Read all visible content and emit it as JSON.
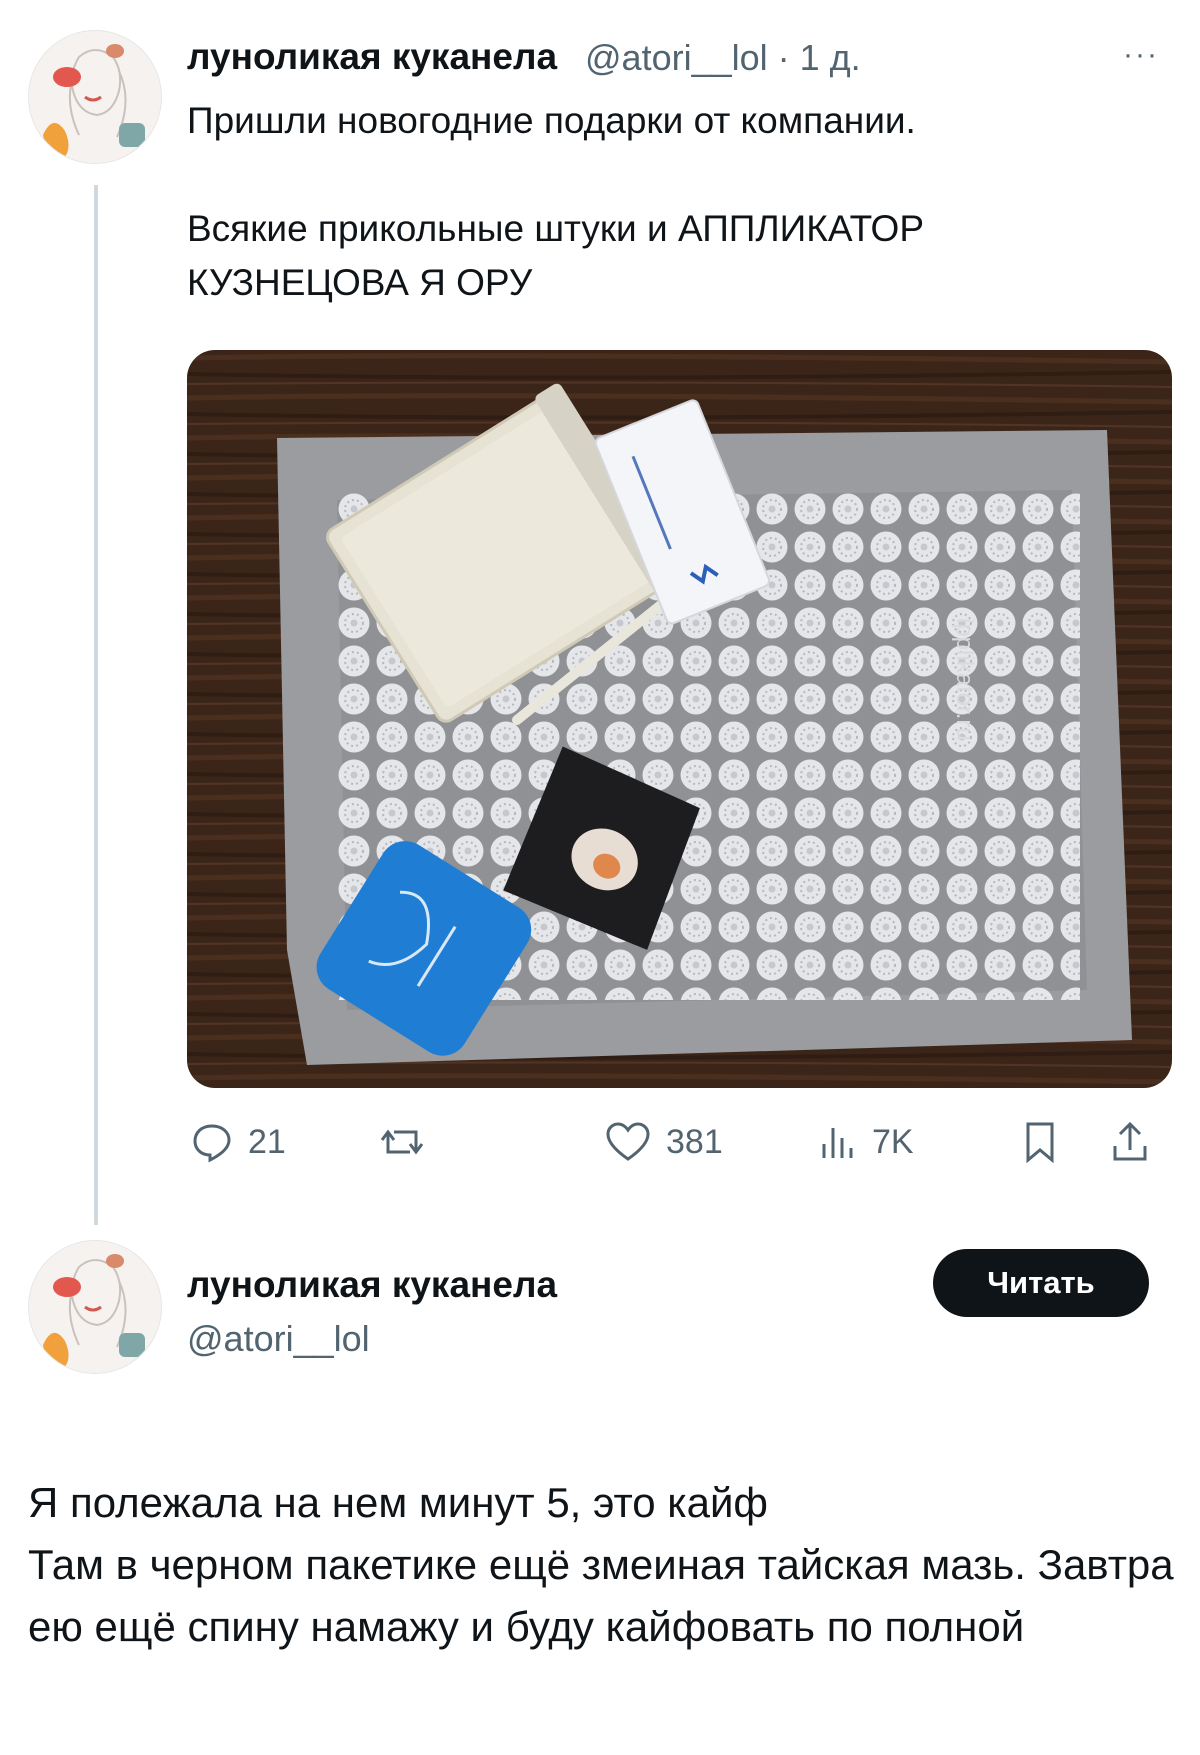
{
  "tweet": {
    "display_name": "луноликая куканела",
    "handle_time": "@atori__lol · 1 д.",
    "more_label": "···",
    "text": "Пришли новогодние подарки от компании.\n\nВсякие прикольные штуки и АППЛИКАТОР КУЗНЕЦОВА Я ОРУ",
    "photo": {
      "watermark": "ipplikator.ru"
    },
    "actions": {
      "replies": "21",
      "retweets": "",
      "likes": "381",
      "views": "7K"
    }
  },
  "profile_card": {
    "display_name": "луноликая куканела",
    "handle": "@atori__lol",
    "button_label": "Читать"
  },
  "reply": {
    "text": "Я полежала на нем минут 5, это кайф\nТам в черном пакетике ещё змеиная тайская мазь. Завтра ею ещё спину намажу и буду кайфовать по полной"
  },
  "colors": {
    "text": "#0f1419",
    "secondary": "#536471",
    "button": "#0f1419",
    "mat": "#9a9ca0",
    "floor": "#3b2518"
  },
  "icons": [
    "reply-icon",
    "retweet-icon",
    "like-icon",
    "views-icon",
    "bookmark-icon",
    "share-icon",
    "more-icon"
  ]
}
